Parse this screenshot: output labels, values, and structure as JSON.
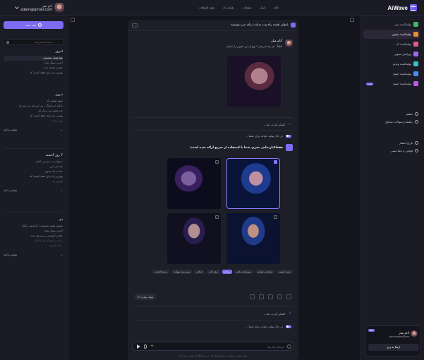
{
  "brand": {
    "name": "AiWave"
  },
  "topnav": [
    "خانه",
    "ابزار",
    "صفحات",
    "نقشه راه",
    "نحوه استفاده"
  ],
  "user": {
    "name": "آدام میلر",
    "email": "adam@gmail.com",
    "email_short": "trentadam@net"
  },
  "left": {
    "new_chat": "چت جدید",
    "search_placeholder": "اینجا جستجو کنید ...",
    "groups": [
      {
        "title": "امروز",
        "items": [
          "نوع هوش مصنوعی",
          "آخرین سوال شما",
          "عناصر تجاری جدید",
          "بهترین راه برای حفظ کیفیت کد"
        ]
      },
      {
        "title": "دیروز",
        "items": [
          "نحوه نوشتن کد",
          "با کلی این فراگ ، می اس اچ، جی اس ای",
          "چند عنصر این تریگر ای",
          "بهترین راه برای حفظ کیفیت کد",
          "تهیه برنامه"
        ]
      },
      {
        "title": "7 روز گذشته",
        "items": [
          "درخواست دسترسی کامل",
          "چند جی اس",
          "ساخت یک تصویر",
          "بهترین راه برای حفظ کیفیت کد",
          "بهترین راه"
        ]
      },
      {
        "title": "دی",
        "items": [
          "نوشتن هوش مصنوعی: گرمایش رایگان",
          "آخرین سوال شما",
          "عناصر آموزشی و پرورش جدید",
          "برنامه تسلیم آزمون 1401",
          "برنامه آزمون"
        ]
      }
    ],
    "more_label": "بیشتر بدانید"
  },
  "right": {
    "items": [
      {
        "label": "تولیدکننده متن",
        "color": "#3fb86b",
        "badge": ""
      },
      {
        "label": "تولیدکننده تصویر",
        "color": "#e6902d",
        "badge": ""
      },
      {
        "label": "تولیدکننده کد",
        "color": "#e55a8a",
        "badge": ""
      },
      {
        "label": "ویرایش تصویر",
        "color": "#9b6af0",
        "badge": ""
      },
      {
        "label": "تولیدکننده ویدئو",
        "color": "#3bc0c9",
        "badge": ""
      },
      {
        "label": "تولیدکننده ایمیل",
        "color": "#4a8ff0",
        "badge": ""
      },
      {
        "label": "تولیدکننده ایمیل",
        "color": "#c05ae0",
        "badge": "جدید"
      }
    ],
    "links": [
      "تنظیم",
      "راهنما و سوالات متداول"
    ],
    "links2": [
      "تاریخ انتشار",
      "قوانین و خط مشی"
    ],
    "upgrade": {
      "name": "آدام میلر",
      "email": "trentadam@net",
      "badge": "Pro",
      "button": "ارتقا به پرو"
    }
  },
  "chat": {
    "title": "عنوان نقشه راه وب سایت برای من بنویسید",
    "user_name": "آدام میلر",
    "user_text": "لطفاً ، هر چه سریعتر ۴ نوع از این تصویر را بسازید",
    "thinking": "اسکن کردن دیتا...",
    "generating": "در حال تولید جواب برای شما...",
    "bot_text": "فقط۴بازنمایی بصری شما با استفاده از سریع ارائه شده است:",
    "tags": [
      "نسبت تصویر",
      "مضطرب ابهامی",
      "نورپردازی ملایم",
      "مرحله",
      "سفر ذاتی",
      "حرکتی",
      "پس زمینه بینهایت",
      "پرتره دلچسب"
    ],
    "regenerate": "تولید دوباره",
    "thinking2": "اسکن کردن دیتا...",
    "generating2": "در حال تولید جواب برای شما...",
    "composer_placeholder": "ارسال یک پیام...",
    "disclaimer": "نسخه هوش مصنوعی می تواند اشتباه کند. در مورد اطلاعات مهم، بررسی کنید."
  }
}
